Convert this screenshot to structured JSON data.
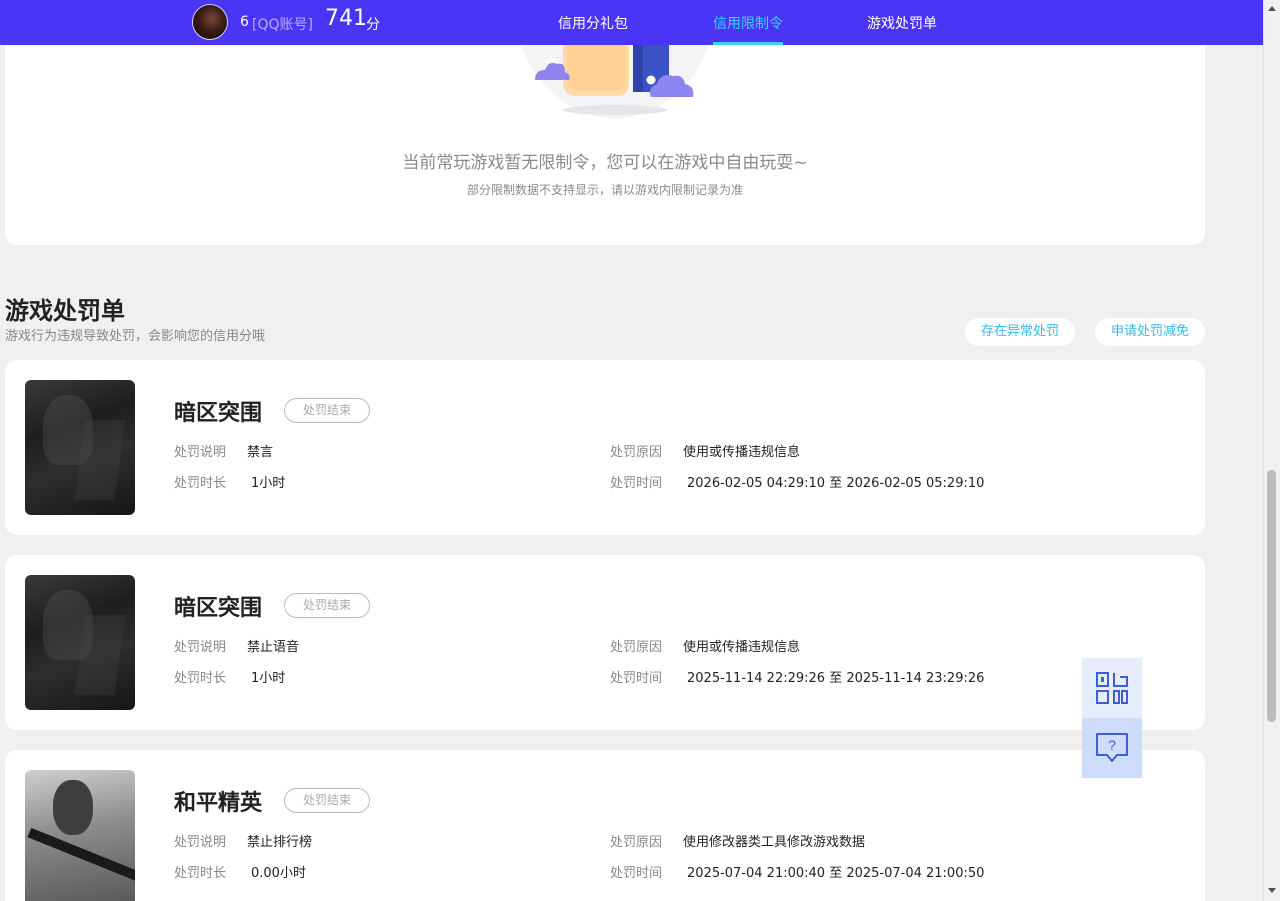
{
  "header": {
    "user_rank": "6",
    "account_label": "[QQ账号]",
    "score": "741",
    "score_unit": "分",
    "tabs": [
      {
        "label": "信用分礼包",
        "active": false
      },
      {
        "label": "信用限制令",
        "active": true
      },
      {
        "label": "游戏处罚单",
        "active": false
      }
    ]
  },
  "restriction": {
    "message": "当前常玩游戏暂无限制令，您可以在游戏中自由玩耍~",
    "note": "部分限制数据不支持显示，请以游戏内限制记录为准"
  },
  "penalties": {
    "title": "游戏处罚单",
    "description": "游戏行为违规导致处罚，会影响您的信用分哦",
    "appeal_button": "存在异常处罚",
    "reduce_button": "申请处罚减免",
    "labels": {
      "desc": "处罚说明",
      "duration": "处罚时长",
      "reason": "处罚原因",
      "time": "处罚时间"
    },
    "items": [
      {
        "game": "暗区突围",
        "status": "处罚结束",
        "desc": "禁言",
        "duration": "1小时",
        "reason": "使用或传播违规信息",
        "time": "2026-02-05 04:29:10 至 2026-02-05 05:29:10"
      },
      {
        "game": "暗区突围",
        "status": "处罚结束",
        "desc": "禁止语音",
        "duration": "1小时",
        "reason": "使用或传播违规信息",
        "time": "2025-11-14 22:29:26 至 2025-11-14 23:29:26"
      },
      {
        "game": "和平精英",
        "status": "处罚结束",
        "desc": "禁止排行榜",
        "duration": "0.00小时",
        "reason": "使用修改器类工具修改游戏数据",
        "time": "2025-07-04 21:00:40 至 2025-07-04 21:00:50"
      }
    ]
  },
  "floating": {
    "qr_icon": "qr-code-icon",
    "help_icon": "help-chat-icon"
  },
  "colors": {
    "brand": "#4a35f5",
    "active_tab": "#3cd4ff",
    "link": "#37b6e8"
  }
}
